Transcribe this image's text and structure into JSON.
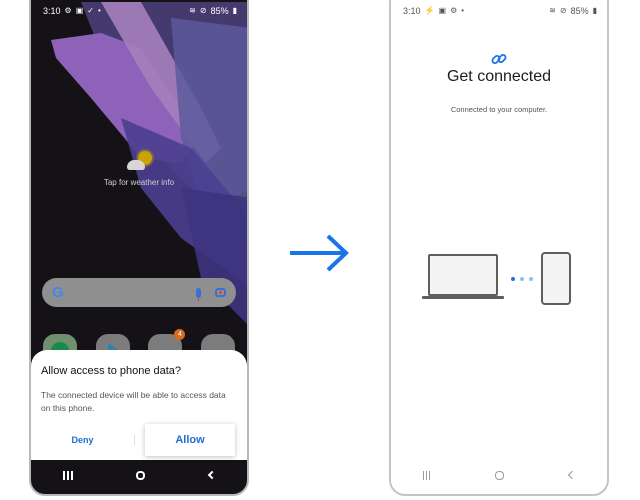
{
  "left_phone": {
    "status_bar": {
      "time": "3:10",
      "left_icons": [
        "settings-icon",
        "gallery-icon",
        "check-icon",
        "dot-icon"
      ],
      "right_icons": [
        "wifi-icon",
        "do-not-disturb-icon"
      ],
      "battery": "85%"
    },
    "weather_widget": {
      "label": "Tap for weather info",
      "icon": "partly-sunny-icon"
    },
    "search_bar": {
      "logo": "G",
      "icons": [
        "mic-icon",
        "lens-icon"
      ]
    },
    "apps": [
      {
        "name": "phone-app"
      },
      {
        "name": "play-store-app"
      },
      {
        "name": "google-folder",
        "badge": "4"
      },
      {
        "name": "samsung-folder"
      }
    ],
    "dialog": {
      "title": "Allow access to phone data?",
      "body": "The connected device will be able to access data on this phone.",
      "deny_label": "Deny",
      "allow_label": "Allow"
    },
    "navbar": {
      "recents": "recents-icon",
      "home": "home-icon",
      "back": "back-icon"
    }
  },
  "arrow": {
    "icon": "right-arrow-icon",
    "color": "#1a73e8"
  },
  "right_phone": {
    "status_bar": {
      "time": "3:10",
      "left_icons": [
        "usb-icon",
        "gallery-icon",
        "settings-icon",
        "dot-icon"
      ],
      "right_icons": [
        "wifi-icon",
        "do-not-disturb-icon"
      ],
      "battery": "85%"
    },
    "link_icon": "link-icon",
    "title": "Get connected",
    "subtitle": "Connected to your computer.",
    "illustration": {
      "laptop": "laptop-icon",
      "dots_colors": [
        "#1a73e8",
        "#8fc1f5",
        "#8fc1f5"
      ],
      "phone": "phone-icon"
    },
    "navbar": {
      "recents": "recents-icon",
      "home": "home-icon",
      "back": "back-icon"
    }
  },
  "colors": {
    "accent": "#1a73e8",
    "dialog_button": "#1a6fd1",
    "badge": "#d66a1e"
  }
}
